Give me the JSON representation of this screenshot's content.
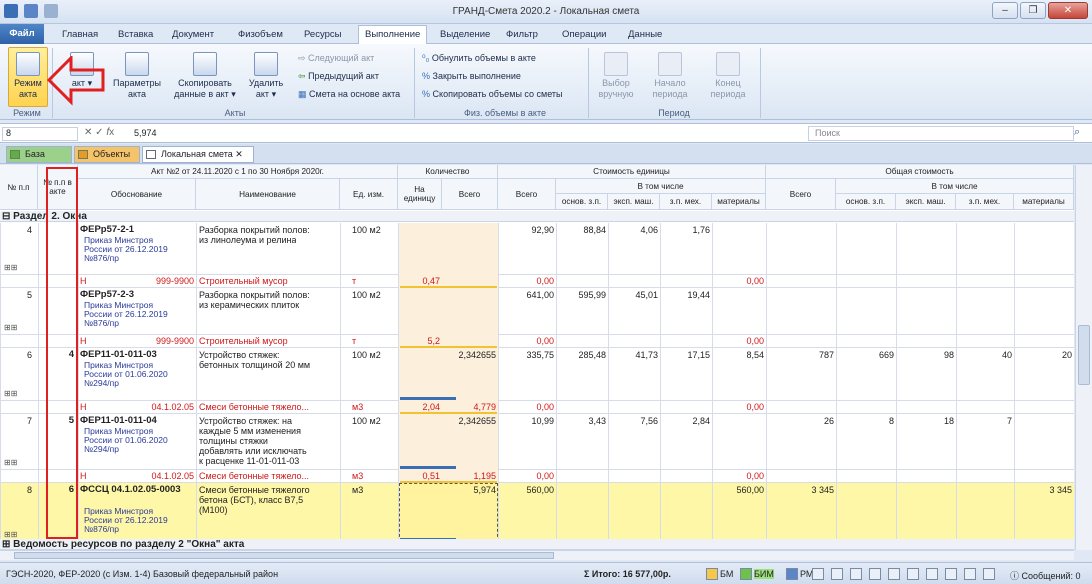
{
  "window": {
    "title": "ГРАНД-Смета 2020.2 - Локальная смета"
  },
  "menu": {
    "tabs": [
      "Файл",
      "Главная",
      "Вставка",
      "Документ",
      "Физобъем",
      "Ресурсы",
      "Выполнение",
      "Выделение",
      "Фильтр",
      "Операции",
      "Данные"
    ],
    "active": "Выполнение"
  },
  "ribbon": {
    "mode_button": "Режим акта",
    "params_button": "Параметры акта",
    "copy_button": "Скопировать данные в акт",
    "delete_button": "Удалить акт",
    "act_menu": "акт",
    "next_act": "Следующий акт",
    "prev_act": "Предыдущий акт",
    "estimate_on_act": "Смета на основе акта",
    "zero_volumes": "Обнулить объемы в акте",
    "close_exec": "Закрыть выполнение",
    "copy_volumes": "Скопировать объемы со сметы",
    "select_manual": "Выбор вручную",
    "period_start": "Начало периода",
    "period_end": "Конец периода",
    "group_mode": "Режим",
    "group_acts": "Акты",
    "group_phys": "Физ. объемы в акте",
    "group_period": "Период"
  },
  "formula": {
    "name_box": "8",
    "value": "5,974",
    "search_placeholder": "Поиск"
  },
  "doc_tabs": {
    "base": "База",
    "objects": "Объекты",
    "local": "Локальная смета"
  },
  "grid": {
    "headers": {
      "num_pp": "№ п.п",
      "num_act": "№ п.п в акте",
      "act_title": "Акт №2 от 24.11.2020 с 1 по 30 Ноября 2020г.",
      "basis": "Обоснование",
      "name": "Наименование",
      "unit": "Ед. изм.",
      "quantity": "Количество",
      "per_unit": "На единицу",
      "total": "Всего",
      "unit_cost": "Стоимость единицы",
      "all": "Всего",
      "incl": "В том числе",
      "total_cost": "Общая стоимость",
      "all2": "Всего",
      "incl2": "В том числе",
      "sub": [
        "основ. з.п.",
        "эксп. маш.",
        "з.п. мех.",
        "материалы"
      ]
    },
    "section": "Раздел 2. Окна",
    "rows": [
      {
        "n": "4",
        "act": "",
        "code": "ФЕРр57-2-1",
        "src": [
          "Приказ Минстроя",
          "России от 26.12.2019",
          "№876/пр"
        ],
        "name": [
          "Разборка покрытий полов:",
          "из линолеума и релина"
        ],
        "unit": "100 м2",
        "qty": "",
        "qtotal": "",
        "all": "92,90",
        "ozp": "88,84",
        "em": "4,06",
        "zpm": "1,76",
        "mat": "",
        "tall": "",
        "tozp": "",
        "tem": "",
        "tzpm": "",
        "tmat": "",
        "res": {
          "h": "Н",
          "code": "999-9900",
          "name": "Строительный мусор",
          "unit": "т",
          "qty": "0,47",
          "qtotal": "",
          "all": "0,00",
          "mat": "0,00"
        }
      },
      {
        "n": "5",
        "act": "",
        "code": "ФЕРр57-2-3",
        "src": [
          "Приказ Минстроя",
          "России от 26.12.2019",
          "№876/пр"
        ],
        "name": [
          "Разборка покрытий полов:",
          "из керамических плиток"
        ],
        "unit": "100 м2",
        "qty": "",
        "qtotal": "",
        "all": "641,00",
        "ozp": "595,99",
        "em": "45,01",
        "zpm": "19,44",
        "mat": "",
        "tall": "",
        "tozp": "",
        "tem": "",
        "tzpm": "",
        "tmat": "",
        "res": {
          "h": "Н",
          "code": "999-9900",
          "name": "Строительный мусор",
          "unit": "т",
          "qty": "5,2",
          "qtotal": "",
          "all": "0,00",
          "mat": "0,00"
        }
      },
      {
        "n": "6",
        "act": "4",
        "code": "ФЕР11-01-011-03",
        "src": [
          "Приказ Минстроя",
          "России от 01.06.2020",
          "№294/пр"
        ],
        "name": [
          "Устройство стяжек:",
          "бетонных толщиной 20 мм"
        ],
        "unit": "100 м2",
        "qty": "",
        "qtotal": "2,342655",
        "all": "335,75",
        "ozp": "285,48",
        "em": "41,73",
        "zpm": "17,15",
        "mat": "8,54",
        "tall": "787",
        "tozp": "669",
        "tem": "98",
        "tzpm": "40",
        "tmat": "20",
        "res": {
          "h": "Н",
          "code": "04.1.02.05",
          "name": "Смеси бетонные тяжело...",
          "unit": "м3",
          "qty": "2,04",
          "qtotal": "4,779",
          "all": "0,00",
          "mat": "0,00"
        }
      },
      {
        "n": "7",
        "act": "5",
        "code": "ФЕР11-01-011-04",
        "src": [
          "Приказ Минстроя",
          "России от 01.06.2020",
          "№294/пр"
        ],
        "name": [
          "Устройство стяжек: на",
          "каждые 5 мм изменения",
          "толщины стяжки",
          "добавлять или исключать",
          "к расценке 11-01-011-03"
        ],
        "unit": "100 м2",
        "qty": "",
        "qtotal": "2,342655",
        "all": "10,99",
        "ozp": "3,43",
        "em": "7,56",
        "zpm": "2,84",
        "mat": "",
        "tall": "26",
        "tozp": "8",
        "tem": "18",
        "tzpm": "7",
        "tmat": "",
        "res": {
          "h": "Н",
          "code": "04.1.02.05",
          "name": "Смеси бетонные тяжело...",
          "unit": "м3",
          "qty": "0,51",
          "qtotal": "1,195",
          "all": "0,00",
          "mat": "0,00"
        }
      },
      {
        "n": "8",
        "act": "6",
        "code": "ФССЦ 04.1.02.05-0003",
        "src": [
          "Приказ Минстроя",
          "России от 26.12.2019",
          "№876/пр"
        ],
        "name": [
          "Смеси бетонные тяжелого",
          "бетона (БСТ), класс В7,5",
          "(М100)"
        ],
        "unit": "м3",
        "qty": "",
        "qtotal": "5,974",
        "all": "560,00",
        "ozp": "",
        "em": "",
        "zpm": "",
        "mat": "560,00",
        "tall": "3 345",
        "tozp": "",
        "tem": "",
        "tzpm": "",
        "tmat": "3 345"
      }
    ],
    "footer_section": "Ведомость ресурсов по разделу 2 \"Окна\" акта"
  },
  "status": {
    "left": "ГЭСН-2020, ФЕР-2020 (с Изм. 1-4)   Базовый федеральный район",
    "total": "Итого: 16 577,00р.",
    "bm": "БМ",
    "bim": "БИМ",
    "rm": "РМ",
    "messages": "Сообщений: 0"
  }
}
